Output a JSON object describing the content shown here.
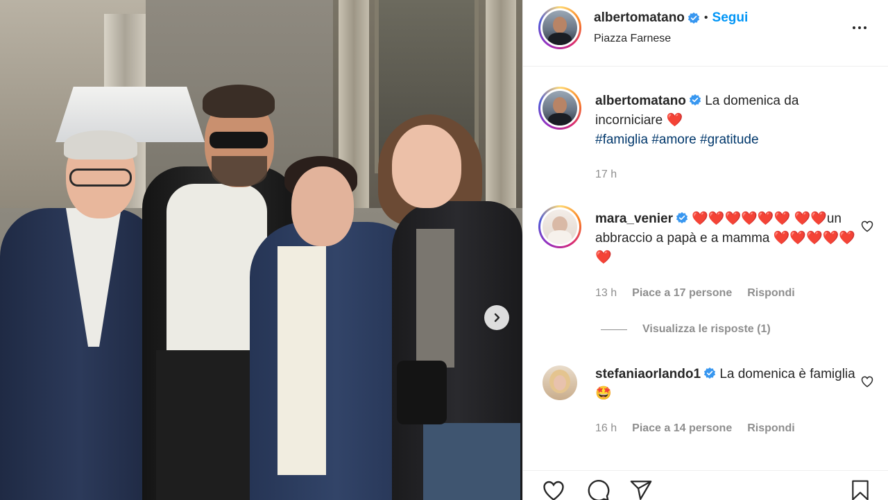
{
  "post": {
    "author": "albertomatano",
    "follow_label": "Segui",
    "separator": "•",
    "location": "Piazza Farnese"
  },
  "caption": {
    "author": "albertomatano",
    "text": "La domenica da incorniciare",
    "emoji": "❤️",
    "hashtags": [
      "#famiglia",
      "#amore",
      "#gratitude"
    ],
    "time": "17 h"
  },
  "comments": [
    {
      "author": "mara_venier",
      "text_hearts_before": "❤️❤️❤️❤️❤️❤️",
      "text_hearts_mid": "❤️❤️",
      "text": "un abbraccio a papà e a mamma",
      "text_hearts_after": "❤️❤️❤️❤️❤️❤️",
      "time": "13 h",
      "likes": "Piace a 17 persone",
      "reply": "Rispondi"
    },
    {
      "author": "stefaniaorlando1",
      "text": "La domenica è famiglia",
      "emoji": "🤩",
      "time": "16 h",
      "likes": "Piace a 14 persone",
      "reply": "Rispondi"
    }
  ],
  "view_replies": "Visualizza le risposte (1)",
  "icons": {
    "verified": "verified-badge-icon",
    "more": "more-options-icon",
    "next": "chevron-right-icon",
    "like": "heart-icon",
    "comment": "comment-icon",
    "share": "share-icon",
    "save": "bookmark-icon"
  },
  "colors": {
    "accent": "#0095f6",
    "hashtag": "#00376b",
    "secondary_text": "#8e8e8e",
    "verified": "#3897f0"
  }
}
